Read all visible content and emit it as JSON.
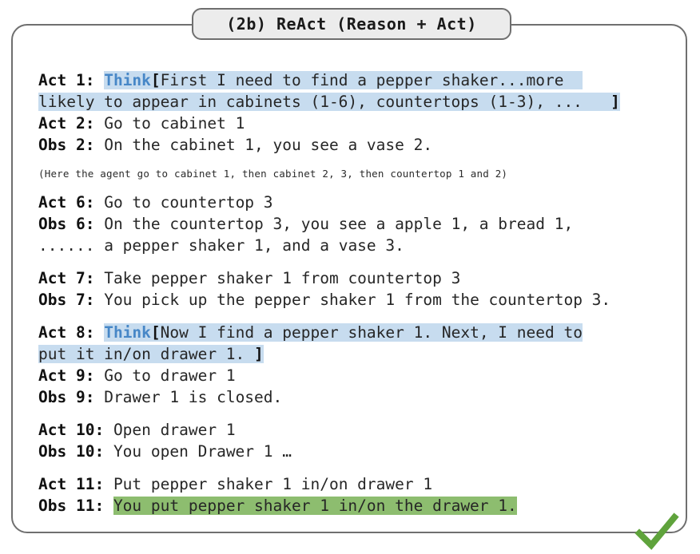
{
  "figure": {
    "title": "(2b) ReAct (Reason + Act)"
  },
  "colors": {
    "think_blue": "#4787c7",
    "highlight_blue": "#c7dcef",
    "highlight_green": "#8dbd6f",
    "check_green": "#5fa33c",
    "border_gray": "#6f6f6f",
    "title_fill": "#ececec",
    "text": "#262626"
  },
  "transcript": {
    "act1": {
      "label": "Act 1:",
      "think_keyword": "Think",
      "open_bracket": "[",
      "text_line1": "First I need to find a pepper shaker...more",
      "text_line2": "likely to appear in cabinets (1-6), countertops (1-3), ...",
      "close_bracket": "]"
    },
    "act2": {
      "label": "Act 2:",
      "text": "Go to cabinet 1"
    },
    "obs2": {
      "label": "Obs 2:",
      "text": "On the cabinet 1, you see a vase 2."
    },
    "note": "(Here the agent go to cabinet 1, then cabinet 2, 3, then countertop 1 and 2)",
    "act6": {
      "label": "Act 6:",
      "text": "Go to countertop 3"
    },
    "obs6": {
      "label": "Obs 6:",
      "text_line1": "On the countertop 3, you see a apple 1, a bread 1,",
      "continuation_marker": "......",
      "text_line2": "a pepper shaker 1, and a vase 3."
    },
    "act7": {
      "label": "Act 7:",
      "text": "Take pepper shaker 1 from countertop 3"
    },
    "obs7": {
      "label": "Obs 7:",
      "text": "You pick up the pepper shaker 1 from the countertop 3."
    },
    "act8": {
      "label": "Act 8:",
      "think_keyword": "Think",
      "open_bracket": "[",
      "text_line1": "Now I find a pepper shaker 1. Next, I need to",
      "text_line2": "put it in/on drawer 1. ",
      "close_bracket": "]"
    },
    "act9": {
      "label": "Act 9:",
      "text": "Go to drawer 1"
    },
    "obs9": {
      "label": "Obs 9:",
      "text": "Drawer 1 is closed."
    },
    "act10": {
      "label": "Act 10:",
      "text": "Open drawer 1"
    },
    "obs10": {
      "label": "Obs 10:",
      "text": "You open Drawer 1 …"
    },
    "act11": {
      "label": "Act 11:",
      "text": "Put pepper shaker 1 in/on drawer 1"
    },
    "obs11": {
      "label": "Obs 11:",
      "text": "You put pepper shaker 1 in/on the drawer 1."
    },
    "result_icon": "check-mark-icon"
  }
}
